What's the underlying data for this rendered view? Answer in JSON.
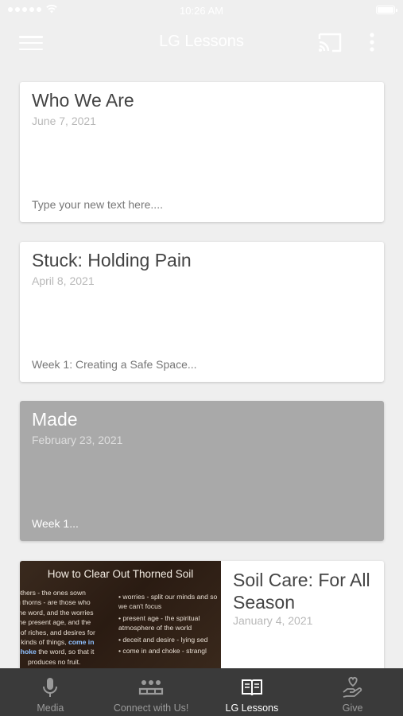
{
  "status_bar": {
    "time": "10:26 AM"
  },
  "app_bar": {
    "title": "LG Lessons",
    "menu_icon": "hamburger-menu-icon",
    "cast_icon": "cast-icon",
    "more_icon": "more-vertical-icon"
  },
  "lessons": [
    {
      "title": "Who We Are",
      "date": "June 7, 2021",
      "excerpt": "Type your new text here...."
    },
    {
      "title": "Stuck: Holding Pain",
      "date": "April 8, 2021",
      "excerpt": "Week 1: Creating a Safe Space..."
    },
    {
      "title": "Made",
      "date": "February 23, 2021",
      "excerpt": "Week 1..."
    },
    {
      "title": "Soil Care: For All Season",
      "date": "January 4, 2021",
      "thumbnail": {
        "title": "How to Clear Out Thorned Soil",
        "left_lines": [
          "others - the ones sown",
          "g thorns - are those who",
          "the word, and the worries",
          "the present age, and the",
          "t of riches, and desires for",
          "r kinds of things, ",
          "come in",
          "choke",
          " the word, so that it",
          "produces no fruit."
        ],
        "right_items": [
          "• worries - split our minds and so we can't focus",
          "• present age - the spiritual atmosphere of the world",
          "• deceit and desire - lying sed",
          "• come in and choke - strangl"
        ]
      }
    }
  ],
  "tabs": [
    {
      "label": "Media",
      "icon": "microphone-icon",
      "active": false
    },
    {
      "label": "Connect with Us!",
      "icon": "group-icon",
      "active": false
    },
    {
      "label": "LG Lessons",
      "icon": "book-icon",
      "active": true
    },
    {
      "label": "Give",
      "icon": "give-hand-heart-icon",
      "active": false
    }
  ],
  "colors": {
    "background": "#efefef",
    "tab_bar": "#3a3a3a",
    "highlight_card": "#a9a9a9"
  }
}
